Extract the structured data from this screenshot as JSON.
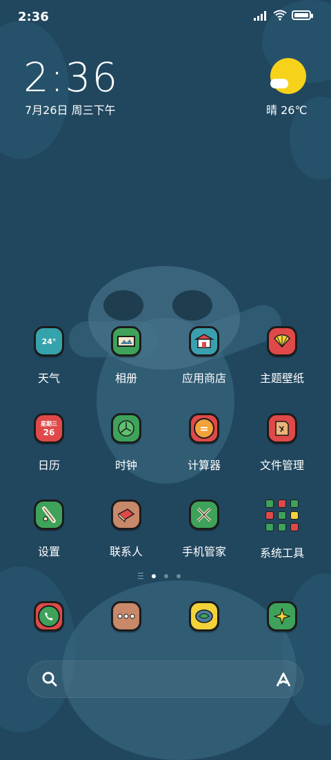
{
  "status_bar": {
    "time": "2:36"
  },
  "clock_widget": {
    "time": "2:36",
    "date": "7月26日 周三下午"
  },
  "weather_widget": {
    "text": "晴 26℃",
    "icon": "sunny-cloud-icon"
  },
  "apps": [
    {
      "label": "天气",
      "icon_text": "24°",
      "icon": "weather-app-icon"
    },
    {
      "label": "相册",
      "icon": "gallery-scroll-icon"
    },
    {
      "label": "应用商店",
      "icon": "app-store-temple-icon"
    },
    {
      "label": "主题壁纸",
      "icon": "theme-fan-icon"
    },
    {
      "label": "日历",
      "icon_text_top": "星期三",
      "icon_text_day": "26",
      "icon": "calendar-icon"
    },
    {
      "label": "时钟",
      "icon": "clock-leaf-icon"
    },
    {
      "label": "计算器",
      "icon_text": "=",
      "icon": "calculator-icon"
    },
    {
      "label": "文件管理",
      "icon": "file-folder-icon"
    },
    {
      "label": "设置",
      "icon": "settings-scroll-icon"
    },
    {
      "label": "联系人",
      "icon": "contacts-book-icon"
    },
    {
      "label": "手机管家",
      "icon": "security-swords-icon"
    },
    {
      "label": "系统工具",
      "icon": "system-tools-folder-icon"
    }
  ],
  "dock": [
    {
      "name": "phone",
      "icon": "phone-icon"
    },
    {
      "name": "messages",
      "icon": "messages-icon"
    },
    {
      "name": "browser",
      "icon": "browser-icon"
    },
    {
      "name": "spark",
      "icon": "sparkle-icon"
    }
  ],
  "pager": {
    "pages": 3,
    "current": 1
  },
  "colors": {
    "background": "#21475f",
    "sun": "#f7d21a",
    "green": "#3ea25a",
    "red": "#e04949"
  }
}
